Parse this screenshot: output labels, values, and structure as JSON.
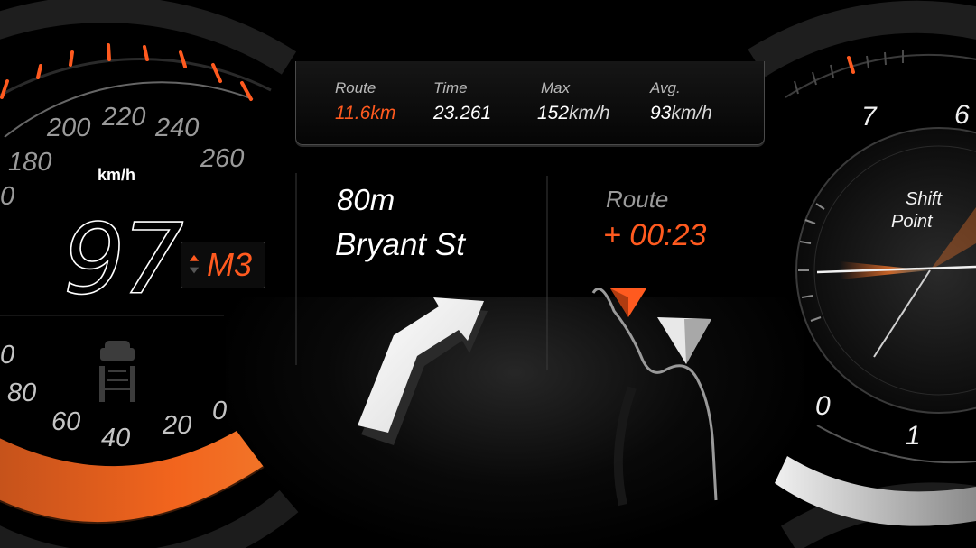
{
  "trip": {
    "route_label": "Route",
    "route_value": "11.6km",
    "time_label": "Time",
    "time_value": "23.261",
    "max_label": "Max",
    "max_value": "152",
    "max_unit": "km/h",
    "avg_label": "Avg.",
    "avg_value": "93",
    "avg_unit": "km/h"
  },
  "navigation": {
    "distance": "80m",
    "street": "Bryant St",
    "route_label": "Route",
    "route_delta": "+ 00:23"
  },
  "speedometer": {
    "unit": "km/h",
    "speed": "97",
    "gear": "M3",
    "scale_labels": [
      "200",
      "220",
      "240",
      "260",
      "180",
      "0",
      "0",
      "80",
      "60",
      "40",
      "20",
      "0"
    ]
  },
  "tachometer": {
    "labels": [
      "7",
      "6",
      "0",
      "1"
    ],
    "shift_point_line1": "Shift",
    "shift_point_line2": "Point"
  },
  "colors": {
    "accent": "#ff5a1f",
    "background": "#000000"
  },
  "icons": [
    "lane-assist-car-icon",
    "turn-arrow-icon",
    "route-map-icon",
    "navigation-pointer-icon"
  ]
}
